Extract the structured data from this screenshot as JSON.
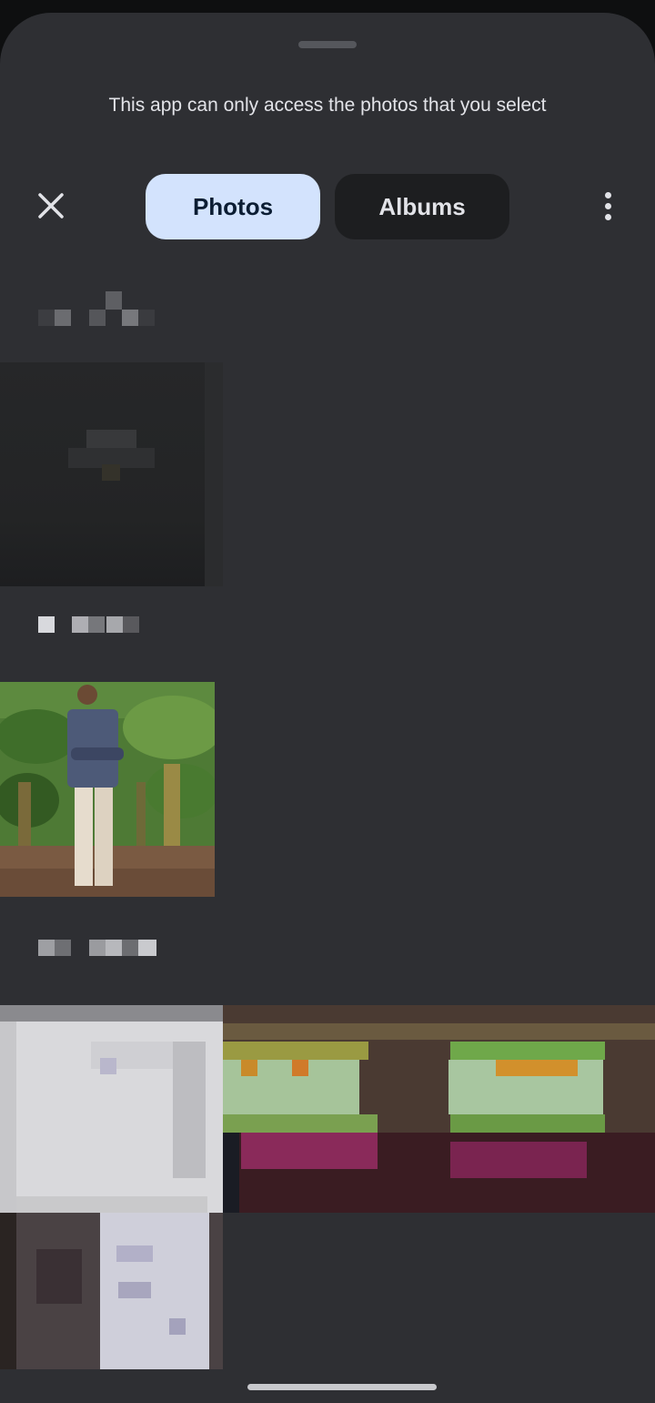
{
  "sheet": {
    "info_text": "This app can only access the photos that you select"
  },
  "tabs": [
    {
      "label": "Photos",
      "selected": true
    },
    {
      "label": "Albums",
      "selected": false
    }
  ],
  "icons": {
    "close": "close-icon",
    "more": "more-vert-icon"
  },
  "colors": {
    "sheet_background": "#2e2f33",
    "selected_tab": "#d3e3fd",
    "unselected_tab": "#1d1e20"
  }
}
